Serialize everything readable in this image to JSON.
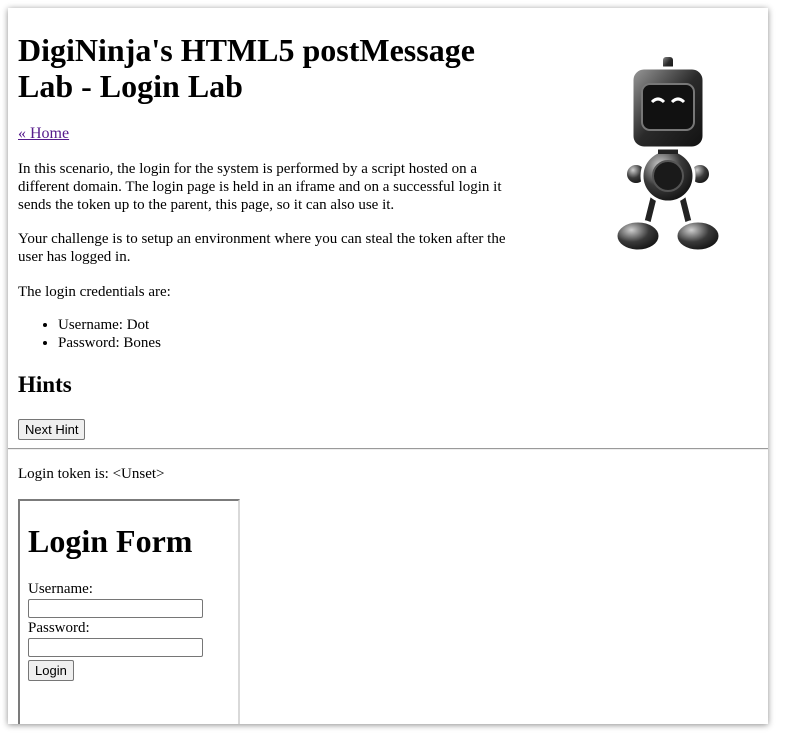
{
  "page": {
    "title": "DigiNinja's HTML5 postMessage Lab - Login Lab",
    "home_link": "« Home",
    "paragraphs": [
      "In this scenario, the login for the system is performed by a script hosted on a different domain. The login page is held in an iframe and on a successful login it sends the token up to the parent, this page, so it can also use it.",
      "Your challenge is to setup an environment where you can steal the token after the user has logged in.",
      "The login credentials are:"
    ],
    "credentials": [
      "Username: Dot",
      "Password: Bones"
    ],
    "hints_heading": "Hints",
    "next_hint_label": "Next Hint",
    "token_line": "Login token is: <Unset>"
  },
  "iframe": {
    "heading": "Login Form",
    "username_label": "Username:",
    "password_label": "Password:",
    "username_value": "",
    "password_value": "",
    "login_label": "Login"
  },
  "logo": {
    "icon": "robot-mascot-icon"
  }
}
